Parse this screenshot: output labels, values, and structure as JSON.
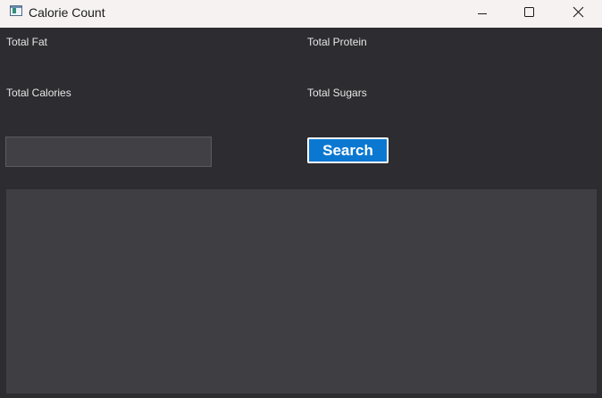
{
  "window": {
    "title": "Calorie Count",
    "controls": [
      "minimize-icon",
      "maximize-icon",
      "close-icon"
    ]
  },
  "labels": {
    "total_fat": "Total Fat",
    "total_protein": "Total Protein",
    "total_calories": "Total Calories",
    "total_sugars": "Total Sugars"
  },
  "search": {
    "value": "",
    "placeholder": "",
    "button_label": "Search"
  },
  "results": {
    "items": []
  },
  "colors": {
    "background": "#2d2c30",
    "panel": "#3f3e43",
    "input": "#414045",
    "accent": "#0a78d1",
    "titlebar": "#f7f2f2"
  }
}
